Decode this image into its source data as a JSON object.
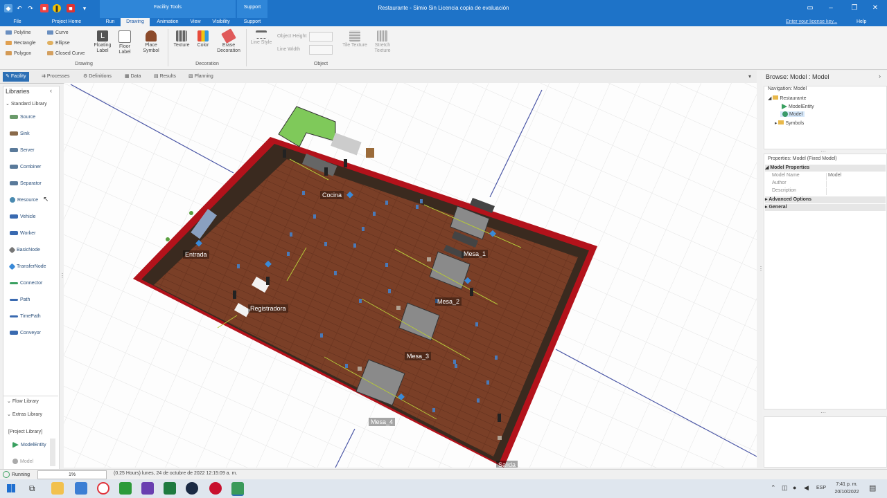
{
  "window": {
    "title": "Restaurante - Simio Sin Licencia copia de evaluación",
    "context_tab_facility": "Facility Tools",
    "context_tab_support": "Support",
    "help": "Help",
    "license_link": "Enter your license key..."
  },
  "ribbon_tabs": [
    "File",
    "Project Home",
    "Run",
    "Drawing",
    "Animation",
    "View",
    "Visibility",
    "Support"
  ],
  "ribbon": {
    "drawing": {
      "polyline": "Polyline",
      "rectangle": "Rectangle",
      "polygon": "Polygon",
      "curve": "Curve",
      "ellipse": "Ellipse",
      "closed_curve": "Closed Curve",
      "floating_label": "Floating Label",
      "floor_label": "Floor Label",
      "place_symbol": "Place Symbol",
      "group_label": "Drawing"
    },
    "decoration": {
      "texture": "Texture",
      "color": "Color",
      "erase_decoration": "Erase Decoration",
      "group_label": "Decoration"
    },
    "object": {
      "line_style": "Line Style",
      "line_width": "Line Width",
      "object_height": "Object Height",
      "tile_texture": "Tile Texture",
      "stretch_texture": "Stretch Texture",
      "group_label": "Object"
    }
  },
  "doc_tabs": [
    "Facility",
    "Processes",
    "Definitions",
    "Data",
    "Results",
    "Planning"
  ],
  "libraries": {
    "title": "Libraries",
    "standard_library": "Standard Library",
    "items": [
      "Source",
      "Sink",
      "Server",
      "Combiner",
      "Separator",
      "Resource",
      "Vehicle",
      "Worker",
      "BasicNode",
      "TransferNode",
      "Connector",
      "Path",
      "TimePath",
      "Conveyor"
    ],
    "flow_library": "Flow Library",
    "extras_library": "Extras Library",
    "project_library": "[Project Library]",
    "project_items": [
      "ModelEntity",
      "Model"
    ]
  },
  "facility_labels": {
    "cocina": "Cocina",
    "entrada": "Entrada",
    "registradora": "Registradora",
    "mesa1": "Mesa_1",
    "mesa2": "Mesa_2",
    "mesa3": "Mesa_3",
    "mesa4": "Mesa_4",
    "salida": "Salida"
  },
  "browse": {
    "title": "Browse: Model : Model",
    "navigation": "Navigation: Model",
    "tree": [
      "Restaurante",
      "ModelEntity",
      "Model",
      "Symbols"
    ],
    "properties_title": "Properties: Model (Fixed Model)",
    "model_properties": "Model Properties",
    "model_name_label": "Model Name",
    "model_name_value": "Model",
    "author_label": "Author",
    "description_label": "Description",
    "advanced_options": "Advanced Options",
    "general": "General"
  },
  "status": {
    "running": "Running",
    "progress": "1%",
    "time": "(0.25 Hours) lunes, 24 de octubre de 2022 12:15:09 a. m."
  },
  "taskbar": {
    "lang": "ESP",
    "time": "7:41 p. m.",
    "date": "20/10/2022"
  }
}
